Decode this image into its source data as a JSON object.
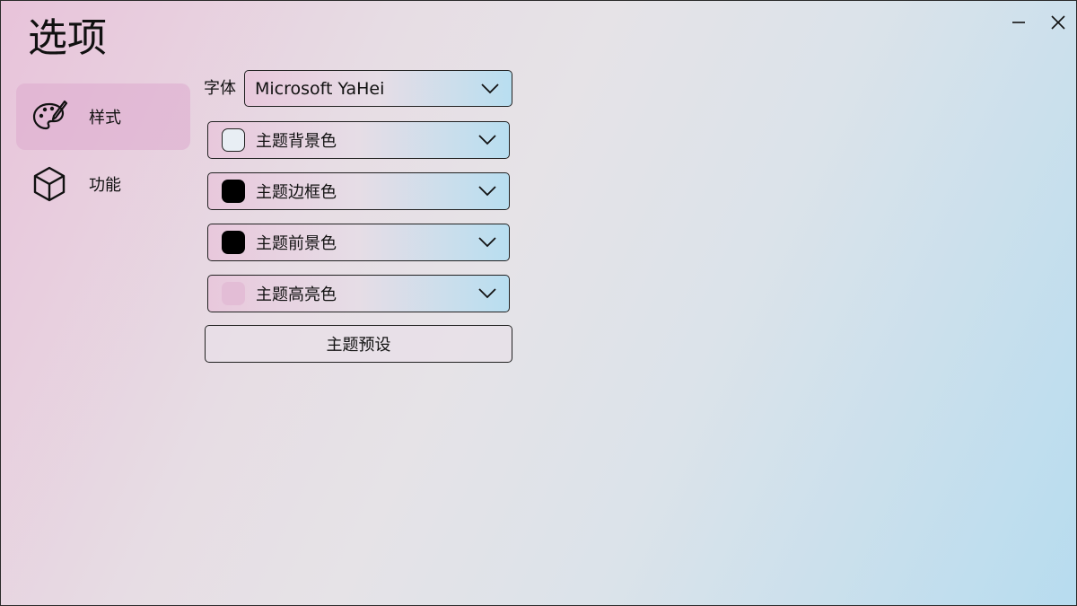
{
  "window": {
    "title": "选项"
  },
  "nav": {
    "items": [
      {
        "label": "样式",
        "icon": "palette-icon",
        "active": true
      },
      {
        "label": "功能",
        "icon": "cube-icon",
        "active": false
      }
    ]
  },
  "settings": {
    "font_label": "字体",
    "font_value": "Microsoft YaHei",
    "color_options": [
      {
        "label": "主题背景色",
        "swatch": "#e8eef4"
      },
      {
        "label": "主题边框色",
        "swatch": "#000000"
      },
      {
        "label": "主题前景色",
        "swatch": "#000000"
      },
      {
        "label": "主题高亮色",
        "swatch": "#e3bdd6"
      }
    ],
    "preset_button": "主题预设"
  }
}
